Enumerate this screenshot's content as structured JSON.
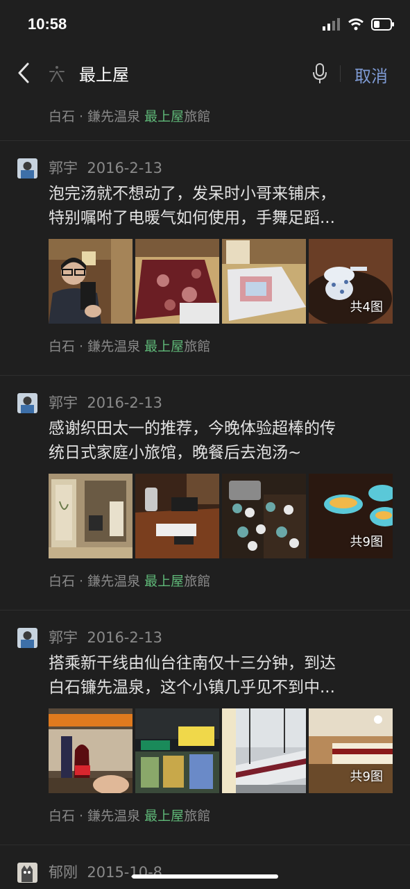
{
  "status_bar": {
    "time": "10:58"
  },
  "search": {
    "query": "最上屋",
    "cancel_label": "取消"
  },
  "top_item": {
    "loc_prefix": "白石 · 鎌先温泉 ",
    "loc_highlight": "最上屋",
    "loc_suffix": "旅館"
  },
  "posts": [
    {
      "author": "郭宇",
      "date": "2016-2-13",
      "text_line1": "泡完汤就不想动了，发呆时小哥来铺床，",
      "text_line2": "特别嘱咐了电暖气如何使用，手舞足蹈...",
      "photo_count": "共4图",
      "loc_prefix": "白石 · 鎌先温泉 ",
      "loc_highlight": "最上屋",
      "loc_suffix": "旅館"
    },
    {
      "author": "郭宇",
      "date": "2016-2-13",
      "text_line1": "感谢织田太一的推荐，今晚体验超棒的传",
      "text_line2": "统日式家庭小旅馆，晚餐后去泡汤~",
      "photo_count": "共9图",
      "loc_prefix": "白石 · 鎌先温泉 ",
      "loc_highlight": "最上屋",
      "loc_suffix": "旅館"
    },
    {
      "author": "郭宇",
      "date": "2016-2-13",
      "text_line1": "搭乘新干线由仙台往南仅十三分钟，到达",
      "text_line2": "白石镰先温泉，这个小镇几乎见不到中...",
      "photo_count": "共9图",
      "loc_prefix": "白石 · 鎌先温泉 ",
      "loc_highlight": "最上屋",
      "loc_suffix": "旅館"
    },
    {
      "author": "郁刚",
      "date": "2015-10-8"
    }
  ],
  "colors": {
    "background": "#1f1f1f",
    "link_blue": "#7e9ad3",
    "highlight_green": "#5fb878"
  }
}
